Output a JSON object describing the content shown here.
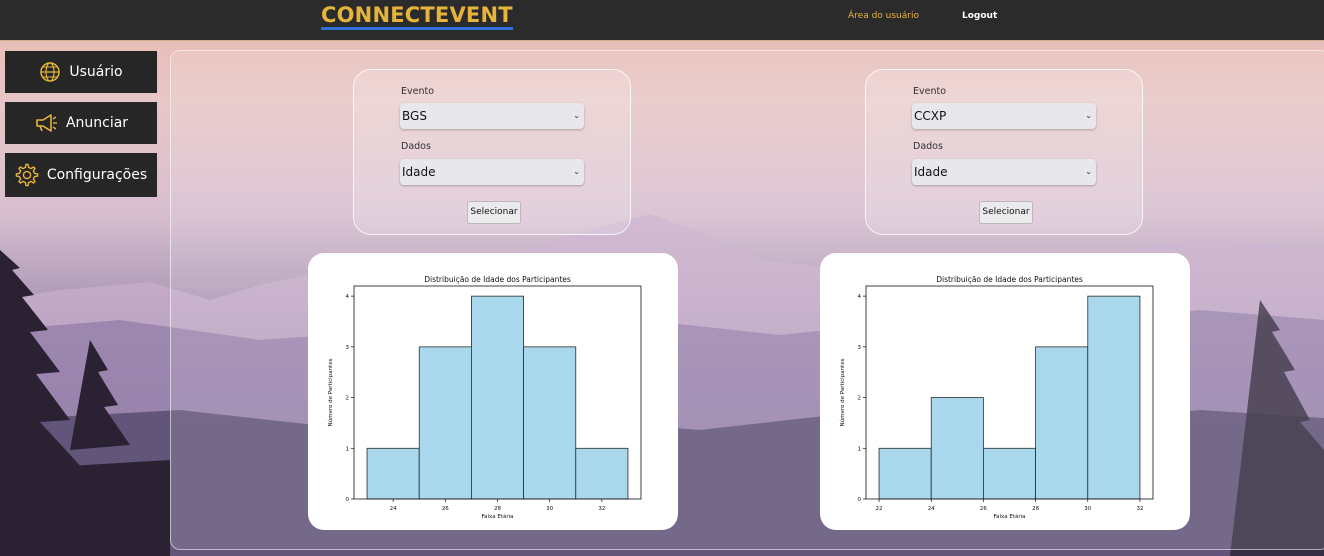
{
  "header": {
    "logo": "CONNECTEVENT",
    "area_link": "Área do usuário",
    "logout_link": "Logout"
  },
  "sidebar": {
    "items": [
      {
        "label": "Usuário",
        "icon": "globe-icon"
      },
      {
        "label": "Anunciar",
        "icon": "megaphone-icon"
      },
      {
        "label": "Configurações",
        "icon": "gear-icon"
      }
    ]
  },
  "forms": [
    {
      "event_label": "Evento",
      "event_value": "BGS",
      "data_label": "Dados",
      "data_value": "Idade",
      "button": "Selecionar"
    },
    {
      "event_label": "Evento",
      "event_value": "CCXP",
      "data_label": "Dados",
      "data_value": "Idade",
      "button": "Selecionar"
    }
  ],
  "colors": {
    "accent": "#e7b43b",
    "topbar": "#2b2b2b",
    "sidebar_button": "#262626",
    "logo_underline": "#2f6fd6",
    "bar_fill": "#a9d8ec"
  },
  "chart_data": [
    {
      "type": "bar",
      "title": "Distribuição de Idade dos Participantes",
      "xlabel": "Faixa Etária",
      "ylabel": "Número de Participantes",
      "bins": [
        [
          23,
          25
        ],
        [
          25,
          27
        ],
        [
          27,
          29
        ],
        [
          29,
          31
        ],
        [
          31,
          33
        ]
      ],
      "values": [
        1,
        3,
        4,
        3,
        1
      ],
      "xlim": [
        22.5,
        33.5
      ],
      "ylim": [
        0,
        4.2
      ],
      "xticks": [
        24,
        26,
        28,
        30,
        32
      ],
      "yticks": [
        0,
        1,
        2,
        3,
        4
      ],
      "grid": false
    },
    {
      "type": "bar",
      "title": "Distribuição de Idade dos Participantes",
      "xlabel": "Faixa Etária",
      "ylabel": "Número de Participantes",
      "bins": [
        [
          22,
          24
        ],
        [
          24,
          26
        ],
        [
          26,
          28
        ],
        [
          28,
          30
        ],
        [
          30,
          32
        ]
      ],
      "values": [
        1,
        2,
        1,
        3,
        4
      ],
      "xlim": [
        21.5,
        32.5
      ],
      "ylim": [
        0,
        4.2
      ],
      "xticks": [
        22,
        24,
        26,
        28,
        30,
        32
      ],
      "yticks": [
        0,
        1,
        2,
        3,
        4
      ],
      "grid": false
    }
  ]
}
